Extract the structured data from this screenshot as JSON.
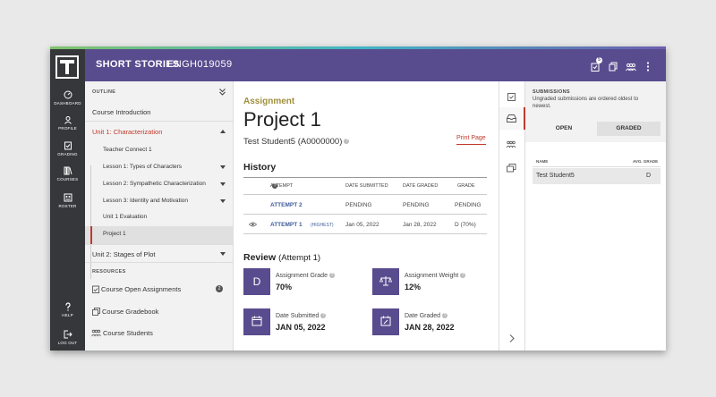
{
  "nav": {
    "dashboard": "DASHBOARD",
    "profile": "PROFILE",
    "grading": "GRADING",
    "courses": "COURSES",
    "roster": "ROSTER",
    "help": "HELP",
    "logout": "LOG OUT"
  },
  "header": {
    "title": "SHORT STORIES",
    "code": "ENGH019059",
    "notification_count": "5"
  },
  "outline": {
    "heading": "OUTLINE",
    "course_intro": "Course Introduction",
    "unit1": "Unit 1: Characterization",
    "teacher_connect": "Teacher Connect 1",
    "lesson1": "Lesson 1: Types of Characters",
    "lesson2": "Lesson 2: Sympathetic Characterization",
    "lesson3": "Lesson 3: Identity and Motivation",
    "unit_eval": "Unit 1 Evaluation",
    "project": "Project 1",
    "unit2": "Unit 2: Stages of Plot",
    "resources_heading": "RESOURCES",
    "open_assignments": "Course Open Assignments",
    "open_assignments_count": "2",
    "gradebook": "Course Gradebook",
    "students": "Course Students"
  },
  "assignment": {
    "eyebrow": "Assignment",
    "title": "Project 1",
    "student": "Test Student5 (A0000000)",
    "print": "Print Page"
  },
  "history": {
    "heading": "History",
    "columns": [
      "ATTEMPT",
      "DATE SUBMITTED",
      "DATE GRADED",
      "GRADE"
    ],
    "rows": [
      {
        "attempt": "ATTEMPT 2",
        "note": "",
        "submitted": "PENDING",
        "graded": "PENDING",
        "grade": "PENDING"
      },
      {
        "attempt": "ATTEMPT 1",
        "note": "(HIGHEST)",
        "submitted": "Jan 05, 2022",
        "graded": "Jan 28, 2022",
        "grade": "D (70%)"
      }
    ]
  },
  "review": {
    "heading": "Review",
    "attempt": "(Attempt 1)",
    "grade_tile": "D",
    "grade_label": "Assignment Grade",
    "grade_value": "70%",
    "weight_label": "Assignment Weight",
    "weight_value": "12%",
    "submitted_label": "Date Submitted",
    "submitted_value": "JAN 05, 2022",
    "graded_label": "Date Graded",
    "graded_value": "JAN 28, 2022"
  },
  "submissions": {
    "heading": "SUBMISSIONS",
    "note": "Ungraded submissions are ordered oldest to newest.",
    "tab_open": "OPEN",
    "tab_graded": "GRADED",
    "col_name": "NAME",
    "col_grade": "AVG. GRADE",
    "rows": [
      {
        "name": "Test Student5",
        "grade": "D"
      }
    ]
  },
  "colors": {
    "header": "#594c8e",
    "nav": "#35373b",
    "accent_red": "#c0392b",
    "eyebrow": "#a08f3c"
  }
}
